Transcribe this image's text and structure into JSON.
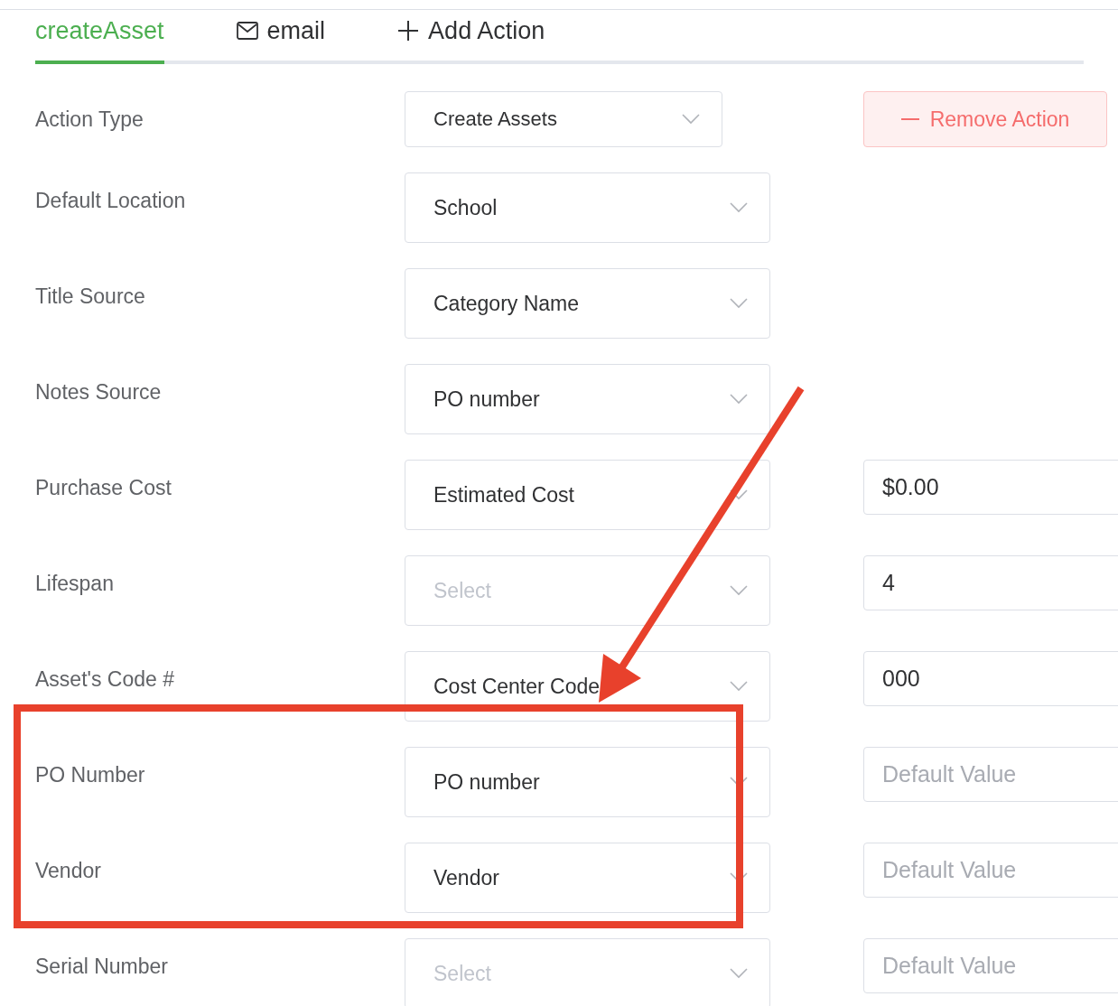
{
  "tabs": [
    {
      "label": "createAsset",
      "kind": "plain",
      "selected": true
    },
    {
      "label": "email",
      "kind": "mail",
      "selected": false
    },
    {
      "label": "Add Action",
      "kind": "add",
      "selected": false
    }
  ],
  "rows": [
    {
      "kind": "action",
      "label": "Action Type",
      "select": {
        "value": "Create Assets"
      },
      "button": {
        "label": "Remove Action"
      }
    },
    {
      "kind": "mapping",
      "label": "Default Location",
      "select": {
        "value": "School"
      }
    },
    {
      "kind": "mapping",
      "label": "Title Source",
      "select": {
        "value": "Category Name"
      }
    },
    {
      "kind": "mapping",
      "label": "Notes Source",
      "select": {
        "value": "PO number"
      }
    },
    {
      "kind": "mapping",
      "label": "Purchase Cost",
      "select": {
        "value": "Estimated Cost"
      },
      "field": {
        "value": "$0.00"
      }
    },
    {
      "kind": "mapping",
      "label": "Lifespan",
      "select": {
        "placeholder": "Select"
      },
      "field": {
        "value": "4"
      }
    },
    {
      "kind": "mapping",
      "label": "Asset's Code #",
      "select": {
        "value": "Cost Center Code"
      },
      "field": {
        "value": "000"
      }
    },
    {
      "kind": "mapping",
      "label": "PO Number",
      "select": {
        "value": "PO number"
      },
      "field": {
        "placeholder": "Default Value"
      }
    },
    {
      "kind": "mapping",
      "label": "Vendor",
      "select": {
        "value": "Vendor"
      },
      "field": {
        "placeholder": "Default Value"
      }
    },
    {
      "kind": "mapping",
      "label": "Serial Number",
      "select": {
        "placeholder": "Select"
      },
      "field": {
        "placeholder": "Default Value"
      }
    }
  ]
}
